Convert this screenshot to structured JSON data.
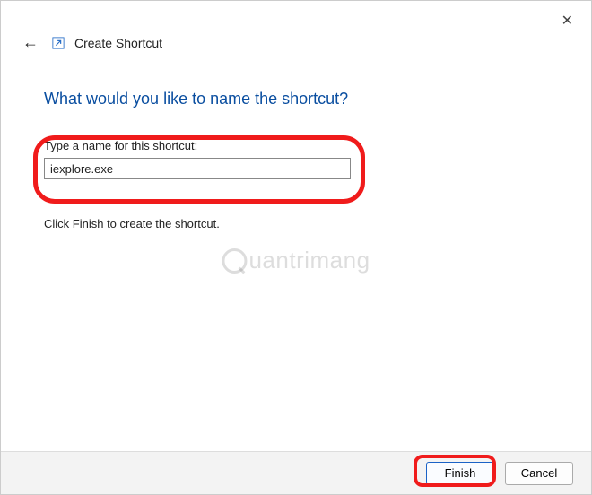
{
  "window": {
    "close_label": "✕"
  },
  "header": {
    "back_glyph": "←",
    "title": "Create Shortcut"
  },
  "main": {
    "heading": "What would you like to name the shortcut?",
    "label": "Type a name for this shortcut:",
    "input_value": "iexplore.exe",
    "finish_hint": "Click Finish to create the shortcut."
  },
  "footer": {
    "finish_label": "Finish",
    "cancel_label": "Cancel"
  },
  "watermark": {
    "text": "uantrimang"
  }
}
